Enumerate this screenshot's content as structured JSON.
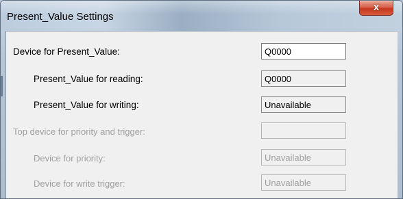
{
  "window": {
    "title": "Present_Value Settings",
    "close_glyph": "x"
  },
  "rows": [
    {
      "label": "Device for Present_Value:",
      "value": "Q0000",
      "state": "edit"
    },
    {
      "label": "Present_Value for reading:",
      "value": "Q0000",
      "state": "readonly"
    },
    {
      "label": "Present_Value for writing:",
      "value": "Unavailable",
      "state": "readonly"
    },
    {
      "label": "Top device for priority and trigger:",
      "value": "",
      "state": "disabled"
    },
    {
      "label": "Device for priority:",
      "value": "Unavailable",
      "state": "disabled"
    },
    {
      "label": "Device for write trigger:",
      "value": "Unavailable",
      "state": "disabled"
    }
  ],
  "colors": {
    "close_button": "#d7624b",
    "dialog_background": "#f0f0f0",
    "disabled_text": "#a0a0a0"
  },
  "icons": {
    "close": "close-icon"
  }
}
